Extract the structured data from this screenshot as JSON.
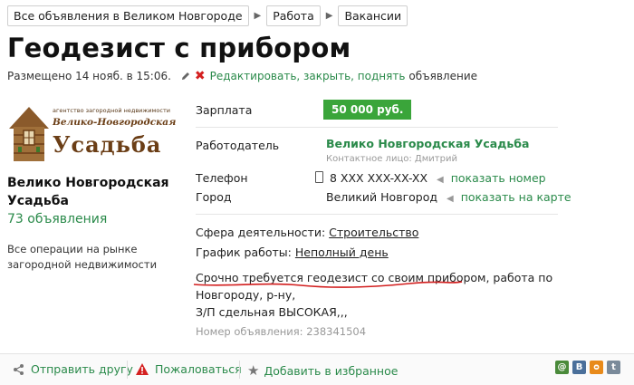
{
  "breadcrumb": [
    "Все объявления в Великом Новгороде",
    "Работа",
    "Вакансии"
  ],
  "title": "Геодезист с прибором",
  "posted": "Размещено 14 нояб. в 15:06.",
  "edit_link": "Редактировать, закрыть, поднять",
  "edit_suffix": "объявление",
  "logo": {
    "top_text": "агентство загородной недвижимости",
    "mid_text": "Велико-Новгородская",
    "big_text": "Усадьба"
  },
  "seller": {
    "name_line1": "Велико Новгородская",
    "name_line2": "Усадьба",
    "count": "73 объявления",
    "desc_line1": "Все операции на рынке",
    "desc_line2": "загородной недвижимости"
  },
  "fields": {
    "salary_label": "Зарплата",
    "salary_value": "50 000 руб.",
    "employer_label": "Работодатель",
    "employer_value": "Велико Новгородская Усадьба",
    "contact": "Контактное лицо: Дмитрий",
    "phone_label": "Телефон",
    "phone_value": "8 XXX XXX-XX-XX",
    "phone_link": "показать номер",
    "city_label": "Город",
    "city_value": "Великий Новгород",
    "city_link": "показать на карте"
  },
  "details": {
    "sphere_label": "Сфера деятельности:",
    "sphere_value": "Строительство",
    "schedule_label": "График работы:",
    "schedule_value": "Неполный день",
    "text_underlined": "Срочно требуется геодезист со своим прибором",
    "text_rest": ", работа по Новгороду, р-ну,",
    "text_line2": "З/П сдельная ВЫСОКАЯ,,,"
  },
  "ad_number": "Номер объявления: 238341504",
  "footer": {
    "send": "Отправить другу",
    "complain": "Пожаловаться",
    "favorite": "Добавить в избранное"
  },
  "colors": {
    "accent_green": "#2a8a4a",
    "salary_bg": "#3aa53a",
    "delete_red": "#d42020"
  }
}
